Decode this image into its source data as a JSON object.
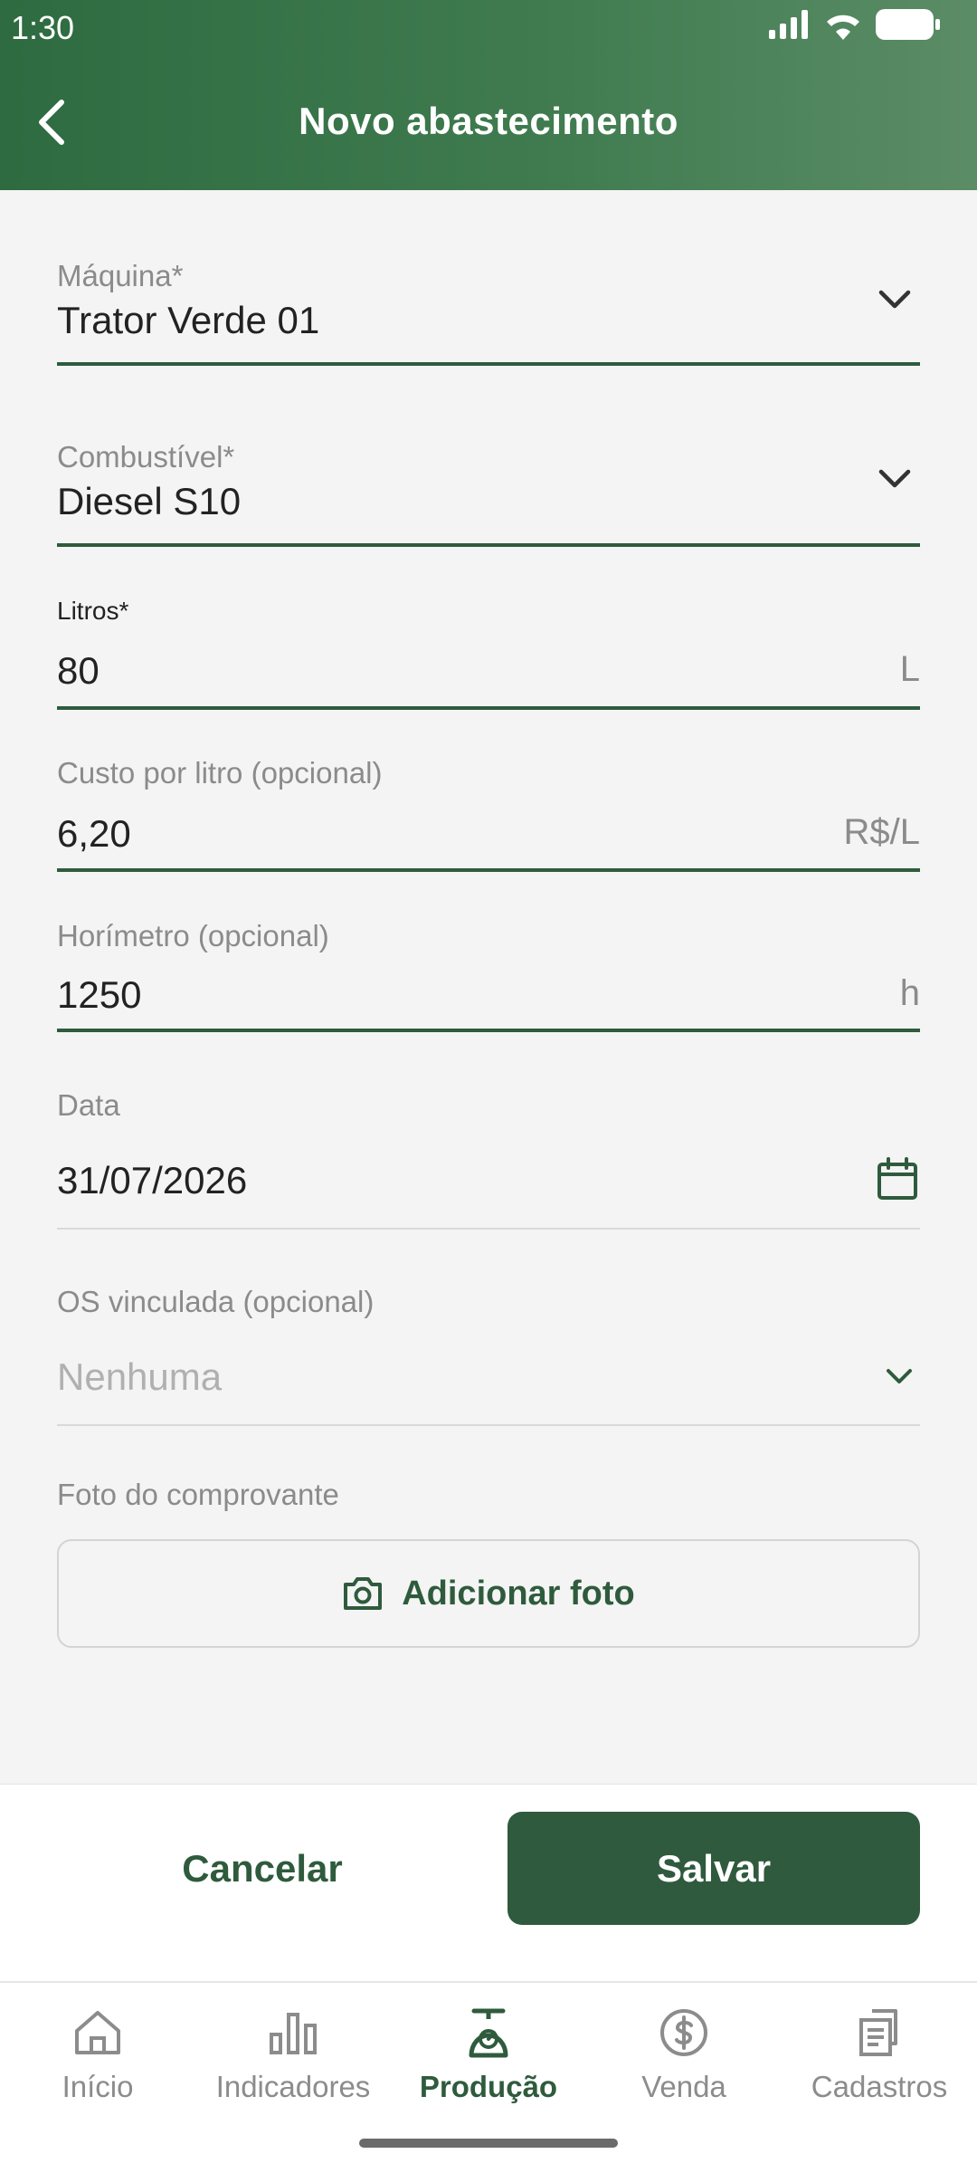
{
  "status_bar": {
    "time": "1:30"
  },
  "header": {
    "title": "Novo abastecimento"
  },
  "form": {
    "maquina": {
      "label": "Máquina*",
      "value": "Trator Verde 01"
    },
    "combustivel": {
      "label": "Combustível*",
      "value": "Diesel S10"
    },
    "litros": {
      "label": "Litros*",
      "value": "80",
      "suffix": "L"
    },
    "custo": {
      "label": "Custo por litro (opcional)",
      "value": "6,20",
      "suffix": "R$/L"
    },
    "horimetro": {
      "label": "Horímetro (opcional)",
      "value": "1250",
      "suffix": "h"
    },
    "data": {
      "label": "Data",
      "value": "31/07/2026"
    },
    "os": {
      "label": "OS vinculada (opcional)",
      "placeholder": "Nenhuma"
    },
    "foto": {
      "label": "Foto do comprovante",
      "button_label": "Adicionar foto"
    }
  },
  "actions": {
    "cancel_label": "Cancelar",
    "save_label": "Salvar"
  },
  "bottom_nav": {
    "items": [
      {
        "label": "Início",
        "icon": "home-icon"
      },
      {
        "label": "Indicadores",
        "icon": "bar-chart-icon"
      },
      {
        "label": "Produção",
        "icon": "scale-icon",
        "active": true
      },
      {
        "label": "Venda",
        "icon": "dollar-circle-icon"
      },
      {
        "label": "Cadastros",
        "icon": "documents-icon"
      }
    ]
  },
  "colors": {
    "primary": "#2f5b3d",
    "header_start": "#2e6b40",
    "header_end": "#5b8c66",
    "background": "#f4f4f4"
  }
}
